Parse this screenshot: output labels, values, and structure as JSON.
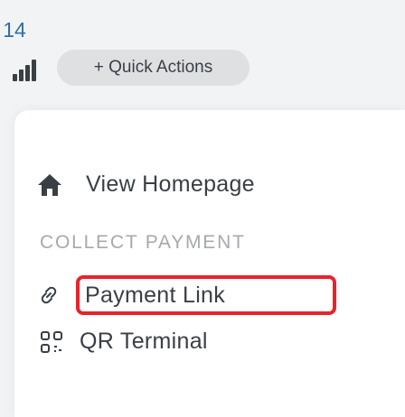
{
  "status_bar": {
    "time": "14",
    "signal_icon": "cellular-signal-icon"
  },
  "header": {
    "quick_actions_label": "+ Quick Actions"
  },
  "menu": {
    "view_homepage": {
      "label": "View Homepage",
      "icon": "home-icon"
    },
    "collect_payment_header": "COLLECT PAYMENT",
    "payment_link": {
      "label": "Payment Link",
      "icon": "link-icon"
    },
    "qr_terminal": {
      "label": "QR Terminal",
      "icon": "qr-code-icon"
    }
  },
  "colors": {
    "accent_highlight": "#e8232c",
    "time_color": "#2f6fa5",
    "header_text": "#a6a9ad"
  }
}
